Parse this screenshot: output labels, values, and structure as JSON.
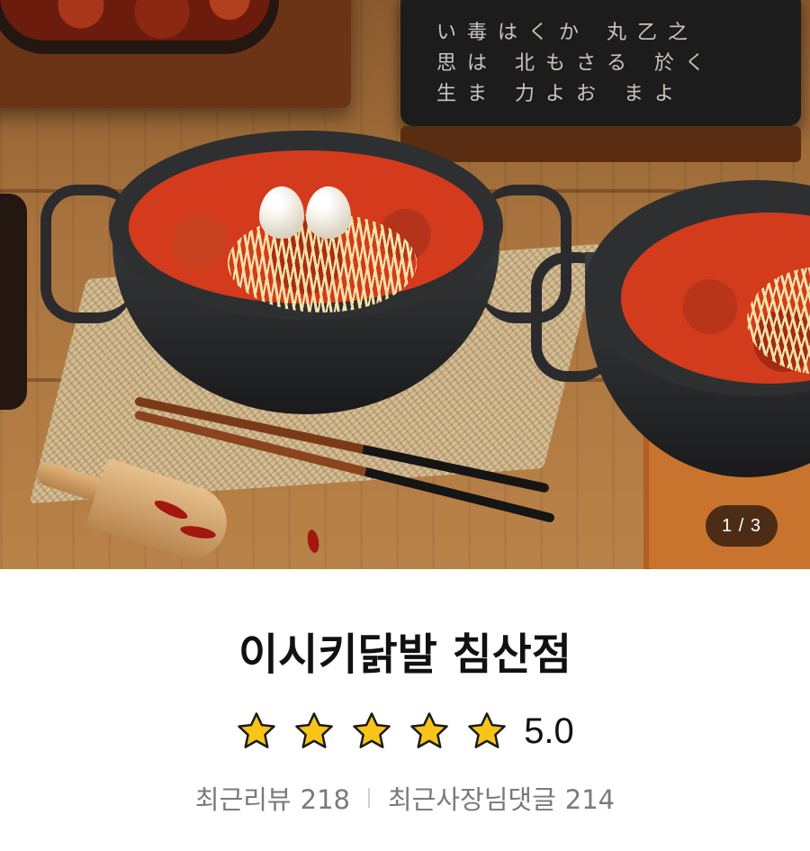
{
  "store": {
    "name": "이시키닭발 침산점"
  },
  "gallery": {
    "current": "1",
    "separator": "/",
    "total": "3",
    "label": "1 / 3"
  },
  "rating": {
    "value": "5.0",
    "stars_filled": 5,
    "stars_max": 5,
    "star_color": "#F9C41A"
  },
  "stats": {
    "recent_reviews_label": "최근리뷰",
    "recent_reviews_count": "218",
    "owner_replies_label": "최근사장님댓글",
    "owner_replies_count": "214"
  },
  "hero": {
    "calligraphy": "い毒はくか 丸乙之\n思は 北もさる 於く\n生ま 力よお まよ"
  }
}
